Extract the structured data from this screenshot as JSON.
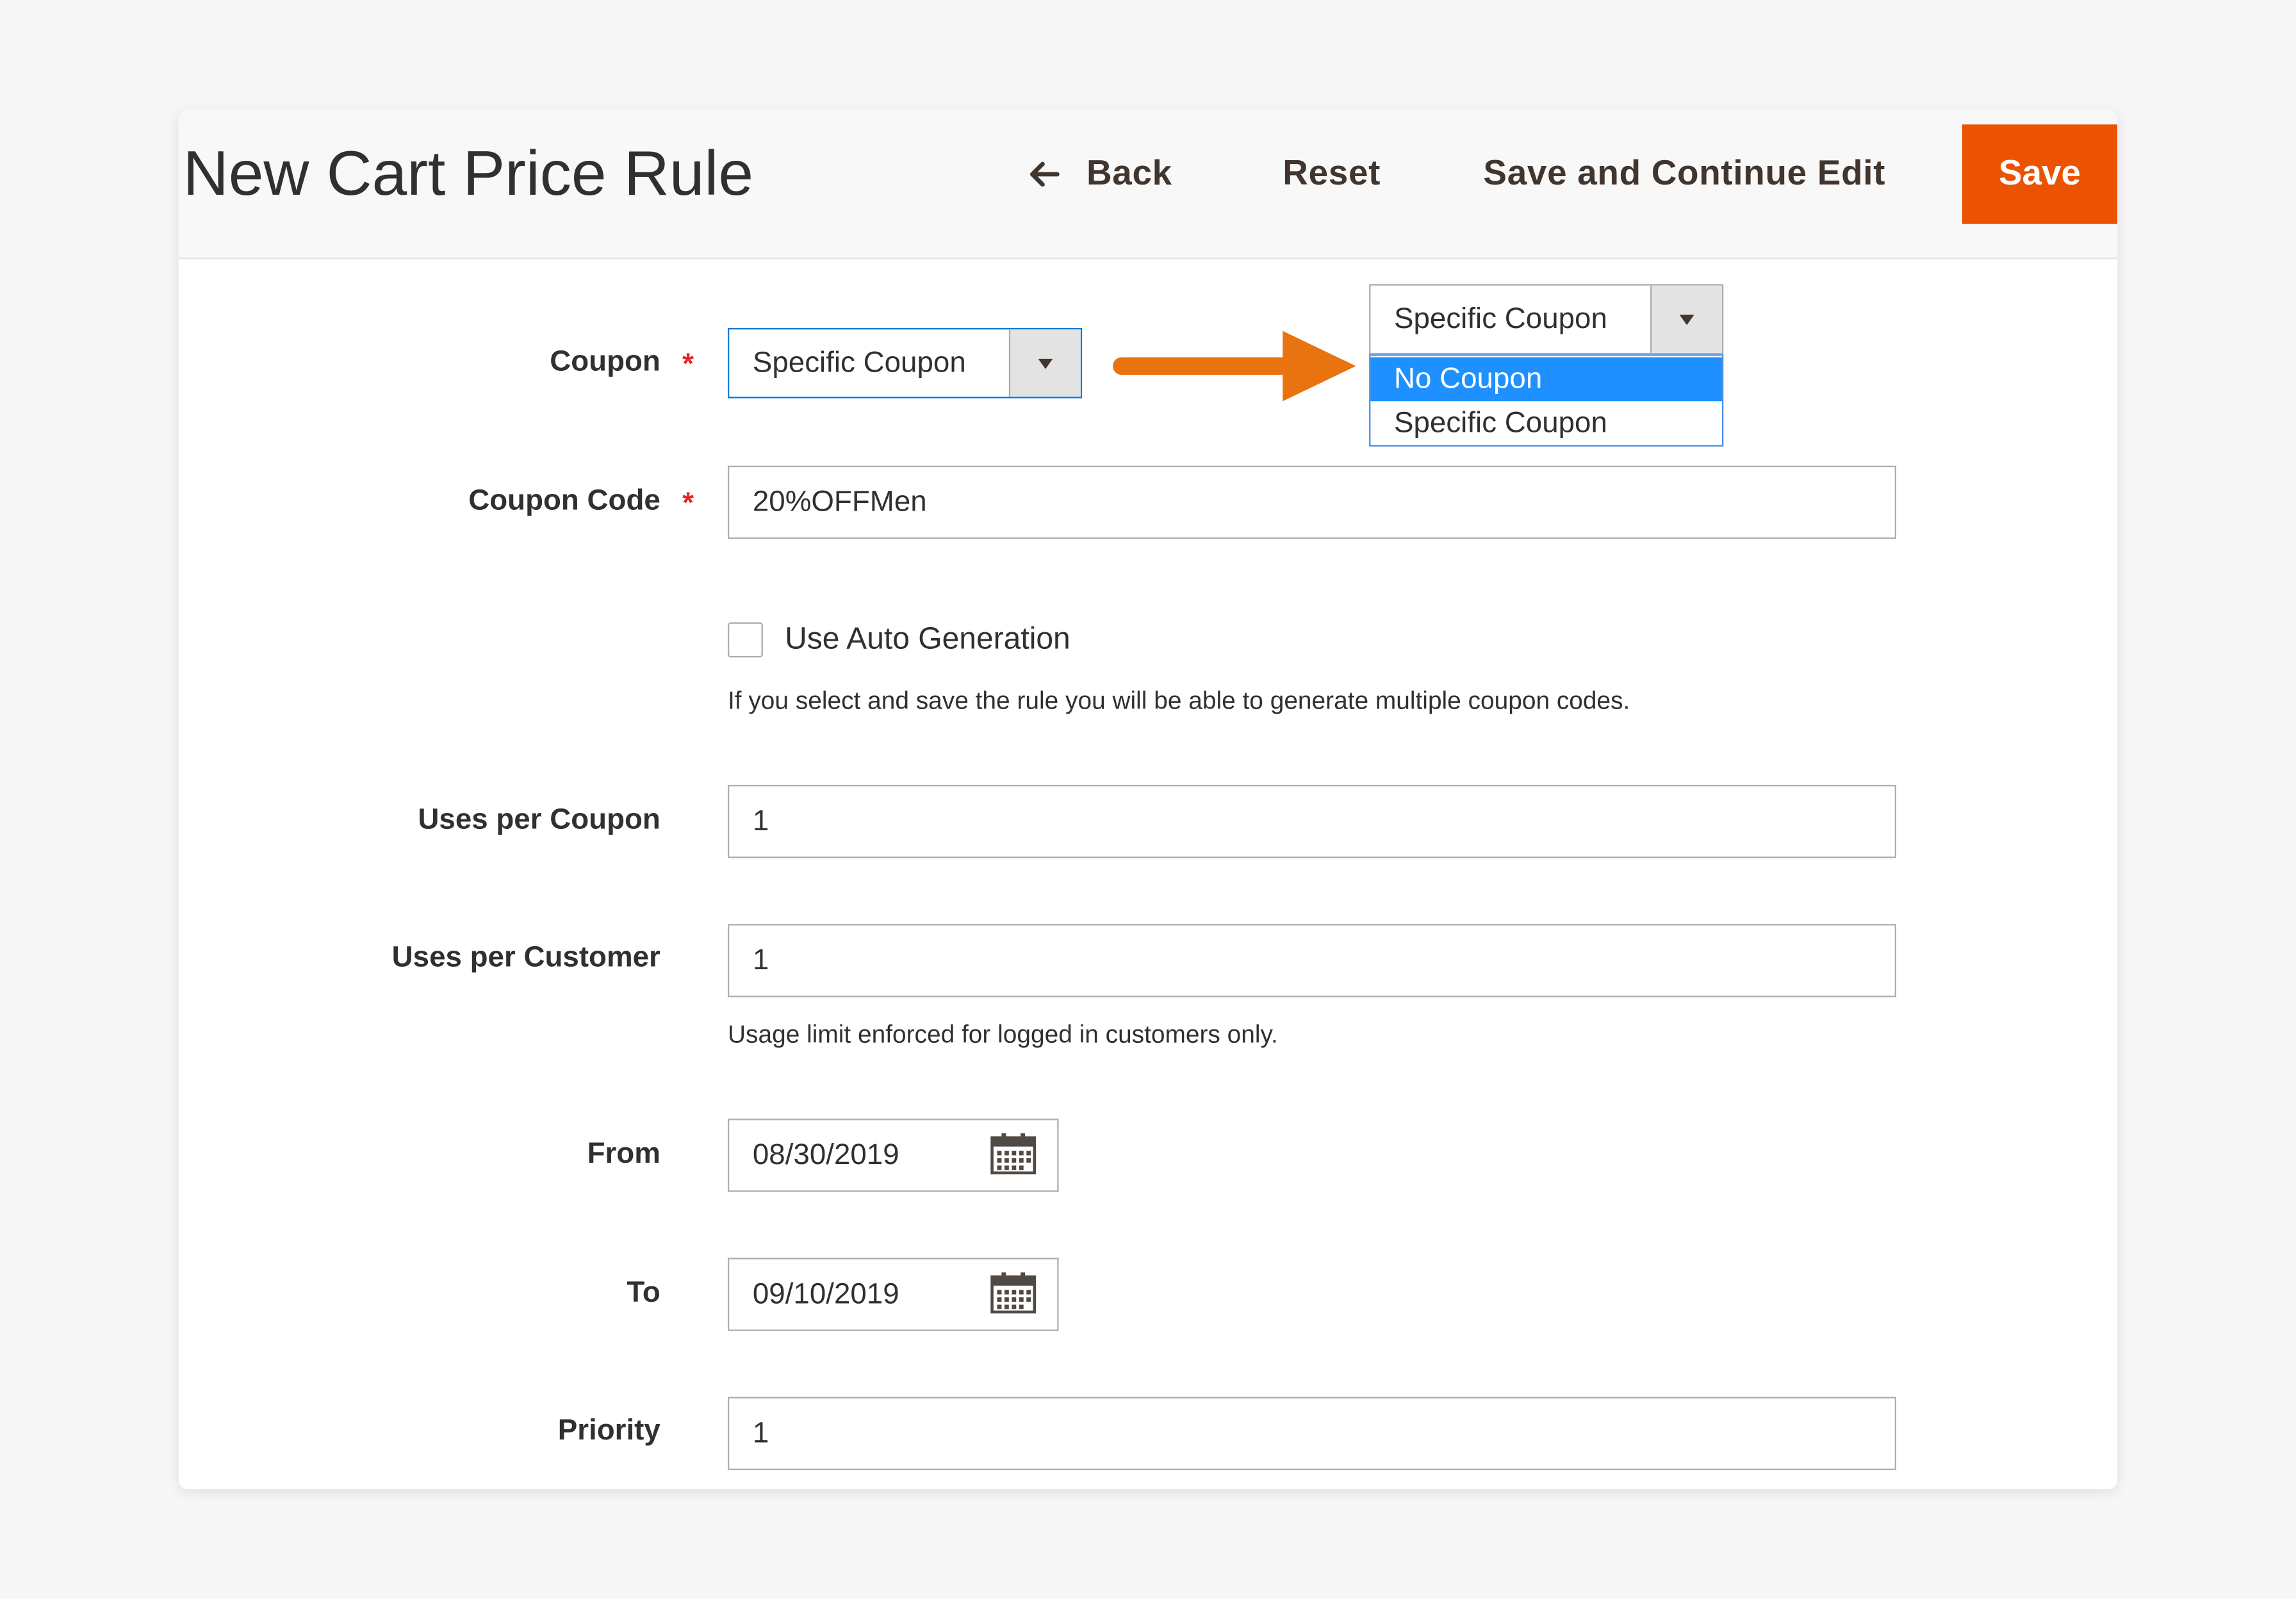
{
  "header": {
    "title": "New Cart Price Rule",
    "back_label": "Back",
    "reset_label": "Reset",
    "save_continue_label": "Save and Continue Edit",
    "save_label": "Save"
  },
  "form": {
    "coupon": {
      "label": "Coupon",
      "required_mark": "*",
      "value": "Specific Coupon"
    },
    "coupon_code": {
      "label": "Coupon Code",
      "required_mark": "*",
      "value": "20%OFFMen"
    },
    "auto_generation": {
      "label": "Use Auto Generation",
      "checked": false,
      "note": "If you select and save the rule you will be able to generate multiple coupon codes."
    },
    "uses_per_coupon": {
      "label": "Uses per Coupon",
      "value": "1"
    },
    "uses_per_customer": {
      "label": "Uses per Customer",
      "value": "1",
      "note": "Usage limit enforced for logged in customers only."
    },
    "from": {
      "label": "From",
      "value": "08/30/2019"
    },
    "to": {
      "label": "To",
      "value": "09/10/2019"
    },
    "priority": {
      "label": "Priority",
      "value": "1"
    }
  },
  "dropdown_popup": {
    "selected_value": "Specific Coupon",
    "options": [
      "No Coupon",
      "Specific Coupon"
    ],
    "highlighted_option": "No Coupon"
  },
  "colors": {
    "save_button": "#eb5202",
    "annotation_arrow": "#e8730f",
    "highlight": "#1e90ff",
    "required": "#e22626"
  },
  "icons": {
    "back": "arrow-left-icon",
    "calendar": "calendar-icon",
    "caret": "caret-down-icon"
  }
}
